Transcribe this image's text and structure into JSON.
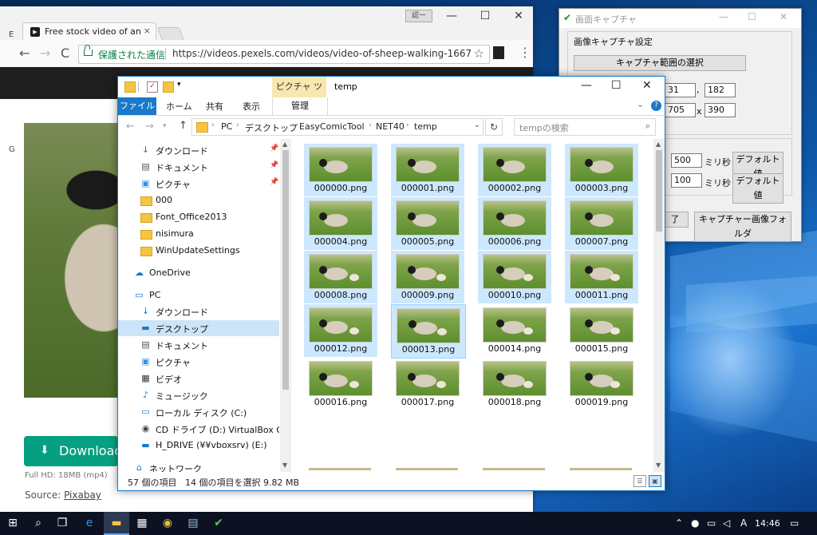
{
  "browser": {
    "tab_title": "Free stock video of animals",
    "tab_close": "×",
    "user_badge": "認ー",
    "minimize": "—",
    "maximize": "☐",
    "close": "✕",
    "back": "←",
    "forward": "→",
    "reload": "C",
    "secure_label": "保護された通信",
    "url": "https://videos.pexels.com/videos/video-of-sheep-walking-1667",
    "bookmark": "☆",
    "menu": "⋮",
    "download_label": "Download",
    "download_arrow": "⬇",
    "fullhd": "Full HD: 18MB (mp4)",
    "source_label": "Source: ",
    "source_link": "Pixabay",
    "side_e": "E",
    "side_g": "G"
  },
  "capture": {
    "title": "画面キャプチャ",
    "minimize": "—",
    "maximize": "☐",
    "close": "✕",
    "group_title": "画像キャプチャ設定",
    "select_range_btn": "キャプチャ範囲の選択",
    "x_value": "31",
    "y_value": "182",
    "w_value": "705",
    "h_value": "390",
    "comma": ",",
    "times": "x",
    "interval1": "500",
    "interval2": "100",
    "ms1": "ミリ秒",
    "ms2": "ミリ秒",
    "default1": "デフォルト値",
    "default2": "デフォルト値",
    "end_btn": "了",
    "folder_btn": "キャプチャー画像フォルダ"
  },
  "explorer": {
    "context_tab": "ピクチャ ツール",
    "title": "temp",
    "minimize": "—",
    "maximize": "☐",
    "close": "✕",
    "ribbon_tabs": [
      "ファイル",
      "ホーム",
      "共有",
      "表示",
      "管理"
    ],
    "help": "?",
    "ribbon_collapse": "⌄",
    "breadcrumb": [
      "PC",
      "デスクトップ",
      "EasyComicTool",
      "NET40",
      "temp"
    ],
    "crumb_sep": "›",
    "search_placeholder": "tempの検索",
    "nav_items": [
      {
        "label": "ダウンロード",
        "icon": "↓",
        "pinned": true
      },
      {
        "label": "ドキュメント",
        "icon": "▤",
        "pinned": true
      },
      {
        "label": "ピクチャ",
        "icon": "▣",
        "pinned": true
      },
      {
        "label": "000",
        "icon": "",
        "pinned": false
      },
      {
        "label": "Font_Office2013",
        "icon": "",
        "pinned": false
      },
      {
        "label": "nisimura",
        "icon": "",
        "pinned": false
      },
      {
        "label": "WinUpdateSettings",
        "icon": "",
        "pinned": false
      },
      {
        "label": "OneDrive",
        "icon": "☁",
        "pinned": false
      },
      {
        "label": "PC",
        "icon": "▭",
        "pinned": false
      },
      {
        "label": "ダウンロード",
        "icon": "↓",
        "pinned": false
      },
      {
        "label": "デスクトップ",
        "icon": "▬",
        "pinned": false
      },
      {
        "label": "ドキュメント",
        "icon": "▤",
        "pinned": false
      },
      {
        "label": "ピクチャ",
        "icon": "▣",
        "pinned": false
      },
      {
        "label": "ビデオ",
        "icon": "▦",
        "pinned": false
      },
      {
        "label": "ミュージック",
        "icon": "♪",
        "pinned": false
      },
      {
        "label": "ローカル ディスク (C:)",
        "icon": "▭",
        "pinned": false
      },
      {
        "label": "CD ドライブ (D:) VirtualBox Guest Ad",
        "icon": "◉",
        "pinned": false
      },
      {
        "label": "H_DRIVE (¥¥vboxsrv) (E:)",
        "icon": "▬",
        "pinned": false
      },
      {
        "label": "ネットワーク",
        "icon": "⌂",
        "pinned": false
      }
    ],
    "files": [
      "000000.png",
      "000001.png",
      "000002.png",
      "000003.png",
      "000004.png",
      "000005.png",
      "000006.png",
      "000007.png",
      "000008.png",
      "000009.png",
      "000010.png",
      "000011.png",
      "000012.png",
      "000013.png",
      "000014.png",
      "000015.png",
      "000016.png",
      "000017.png",
      "000018.png",
      "000019.png"
    ],
    "selected_count": 14,
    "status_items": "57 個の項目",
    "status_selected": "14 個の項目を選択  9.82 MB"
  },
  "taskbar": {
    "clock": "14:46",
    "ime": "A"
  }
}
